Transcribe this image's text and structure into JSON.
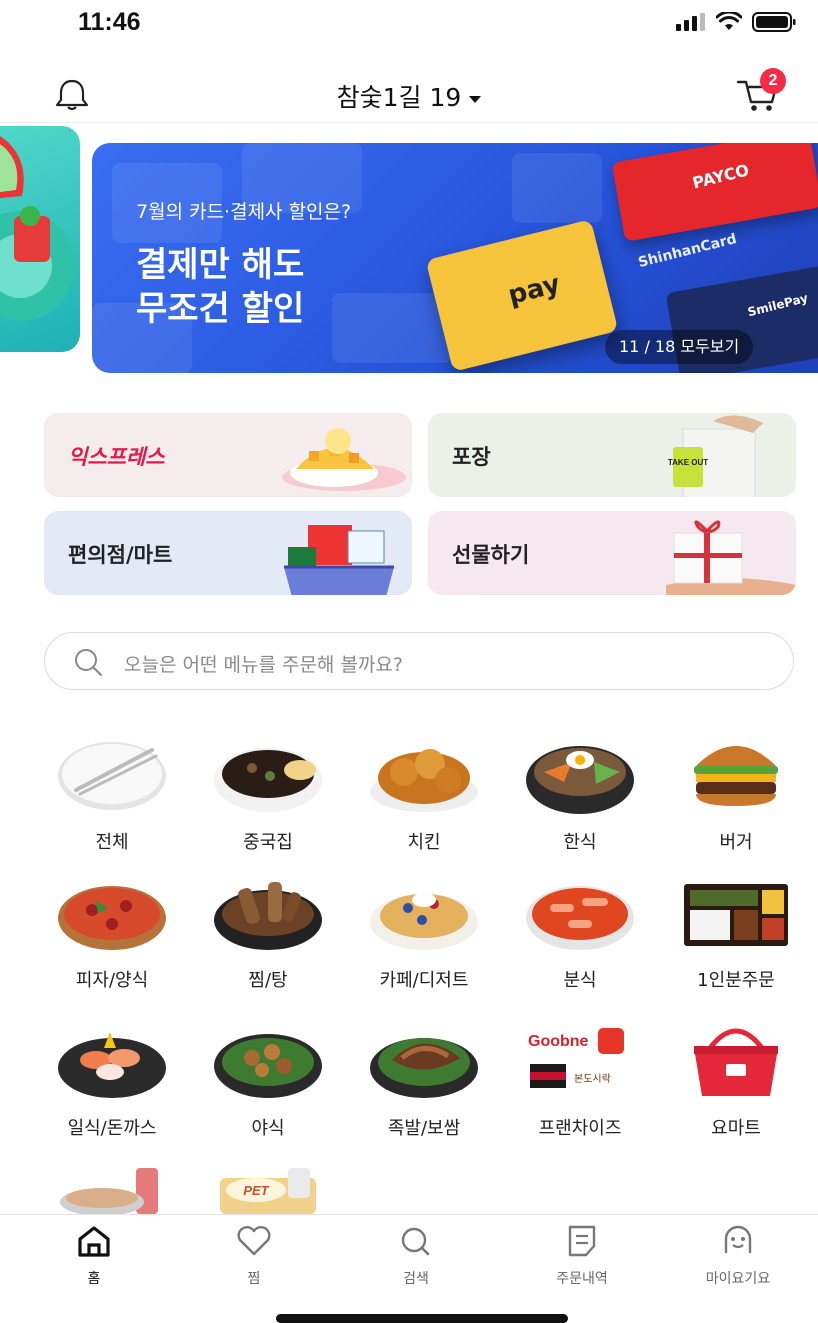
{
  "status": {
    "time": "11:46"
  },
  "header": {
    "address": "참숯1길 19",
    "cart_count": "2"
  },
  "banner": {
    "subtitle": "7월의 카드·결제사 할인은?",
    "title_line1": "결제만 해도",
    "title_line2": "무조건 할인",
    "pager": "11 / 18 모두보기",
    "pay_label": "pay",
    "payco_label": "PAYCO",
    "shinhan_label": "ShinhanCard",
    "smile_label": "SmilePay"
  },
  "services": [
    {
      "label": "익스프레스"
    },
    {
      "label": "포장"
    },
    {
      "label": "편의점/마트"
    },
    {
      "label": "선물하기"
    }
  ],
  "service_art": {
    "takeout_label": "TAKE OUT"
  },
  "search": {
    "placeholder": "오늘은 어떤 메뉴를 주문해 볼까요?"
  },
  "categories": [
    {
      "name": "전체"
    },
    {
      "name": "중국집"
    },
    {
      "name": "치킨"
    },
    {
      "name": "한식"
    },
    {
      "name": "버거"
    },
    {
      "name": "피자/양식"
    },
    {
      "name": "찜/탕"
    },
    {
      "name": "카페/디저트"
    },
    {
      "name": "분식"
    },
    {
      "name": "1인분주문"
    },
    {
      "name": "일식/돈까스"
    },
    {
      "name": "야식"
    },
    {
      "name": "족발/보쌈"
    },
    {
      "name": "프랜차이즈"
    },
    {
      "name": "요마트"
    }
  ],
  "franchise_art": {
    "goobne": "Goobne",
    "bondo": "본도시락"
  },
  "partial_art": {
    "pet": "PET"
  },
  "nav": [
    {
      "label": "홈",
      "icon": "home-icon"
    },
    {
      "label": "찜",
      "icon": "heart-icon"
    },
    {
      "label": "검색",
      "icon": "search-icon"
    },
    {
      "label": "주문내역",
      "icon": "order-list-icon"
    },
    {
      "label": "마이요기요",
      "icon": "profile-icon"
    }
  ],
  "colors": {
    "accent": "#fa2a47",
    "banner": "#2f62e6"
  }
}
